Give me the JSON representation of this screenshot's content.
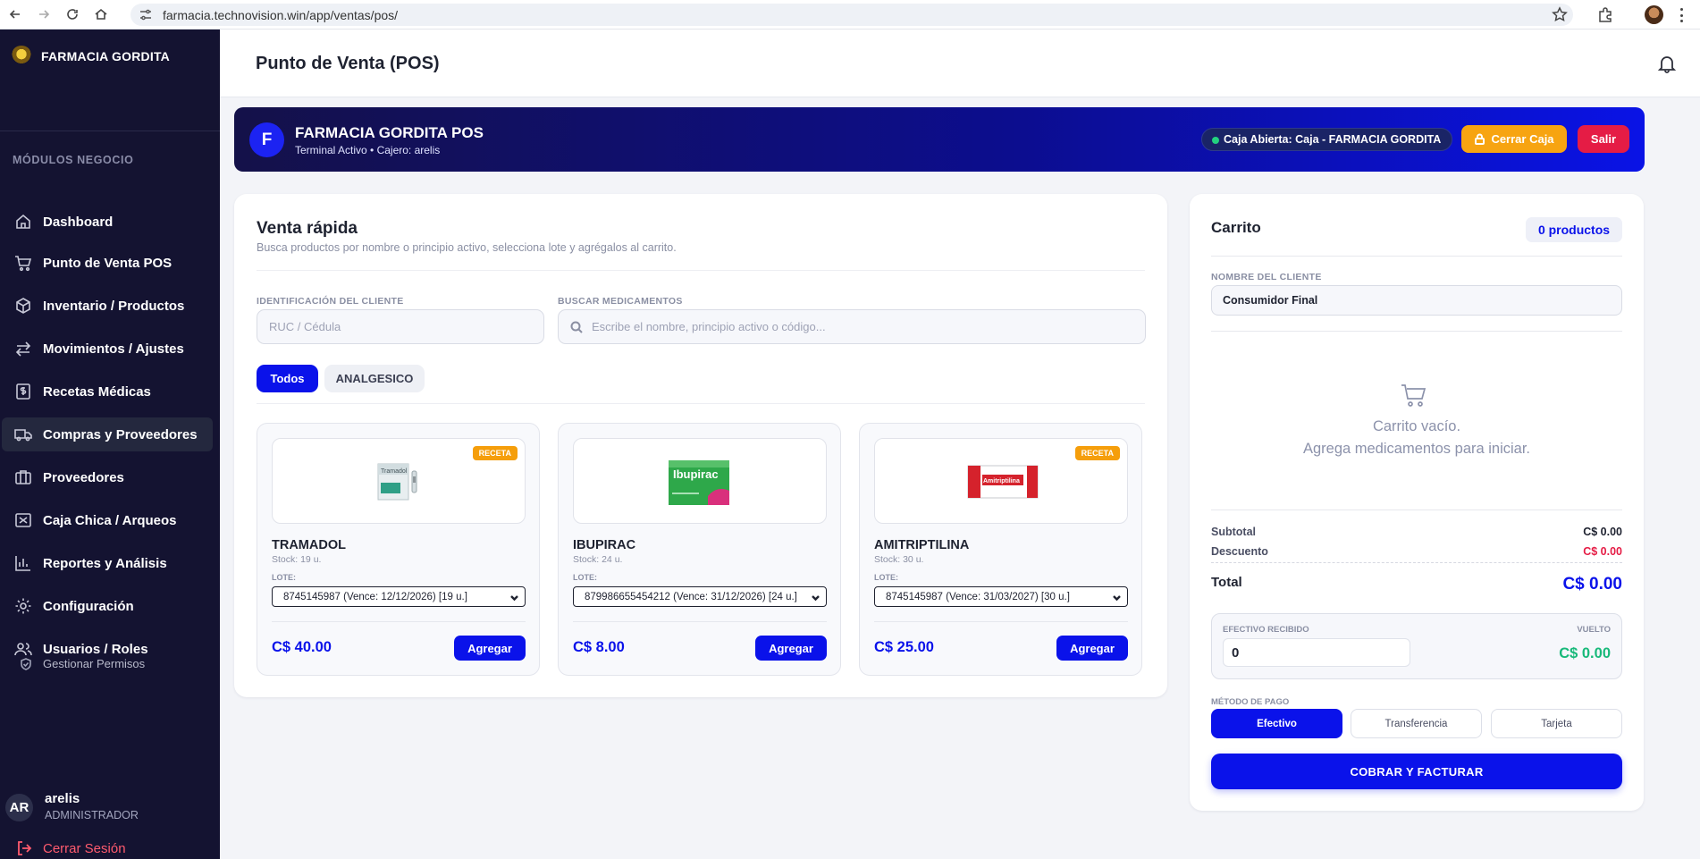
{
  "browser": {
    "url": "farmacia.technovision.win/app/ventas/pos/"
  },
  "sidebar": {
    "brand": "FARMACIA GORDITA",
    "section_label": "MÓDULOS NEGOCIO",
    "items": [
      {
        "label": "Dashboard",
        "icon": "home-icon"
      },
      {
        "label": "Punto de Venta POS",
        "icon": "cart-icon"
      },
      {
        "label": "Inventario / Productos",
        "icon": "box-icon"
      },
      {
        "label": "Movimientos / Ajustes",
        "icon": "arrows-icon"
      },
      {
        "label": "Recetas Médicas",
        "icon": "prescription-icon"
      },
      {
        "label": "Compras y Proveedores",
        "icon": "truck-icon",
        "active": true
      },
      {
        "label": "Proveedores",
        "icon": "building-icon"
      },
      {
        "label": "Caja Chica / Arqueos",
        "icon": "cash-icon"
      },
      {
        "label": "Reportes y Análisis",
        "icon": "chart-icon"
      },
      {
        "label": "Configuración",
        "icon": "gear-icon"
      },
      {
        "label": "Usuarios / Roles",
        "icon": "users-icon"
      }
    ],
    "sub_item": "Gestionar Permisos",
    "user": {
      "initials": "AR",
      "name": "arelis",
      "role": "ADMINISTRADOR"
    },
    "logout": "Cerrar Sesión"
  },
  "header": {
    "title": "Punto de Venta (POS)"
  },
  "banner": {
    "letter": "F",
    "title": "FARMACIA GORDITA POS",
    "subtitle": "Terminal Activo • Cajero: arelis",
    "status": "Caja Abierta: Caja - FARMACIA GORDITA",
    "close_cash": "Cerrar Caja",
    "exit": "Salir",
    "colors": {
      "status_dot": "#23d27f",
      "close_cash": "#f7a411",
      "exit": "#e51c45"
    }
  },
  "sale": {
    "title": "Venta rápida",
    "subtitle": "Busca productos por nombre o principio activo, selecciona lote y agrégalos al carrito.",
    "client_id_label": "IDENTIFICACIÓN DEL CLIENTE",
    "client_id_placeholder": "RUC / Cédula",
    "search_label": "BUSCAR MEDICAMENTOS",
    "search_placeholder": "Escribe el nombre, principio activo o código...",
    "filters": [
      "Todos",
      "ANALGESICO"
    ],
    "lote_label": "LOTE:",
    "add_label": "Agregar",
    "badge_label": "RECETA",
    "products": [
      {
        "name": "TRAMADOL",
        "stock": "Stock: 19 u.",
        "lote": "8745145987 (Vence: 12/12/2026) [19 u.]",
        "price": "C$ 40.00",
        "receta": true,
        "box_name": "Tramadol"
      },
      {
        "name": "IBUPIRAC",
        "stock": "Stock: 24 u.",
        "lote": "879986655454212 (Vence: 31/12/2026) [24 u.]",
        "price": "C$ 8.00",
        "receta": false,
        "box_name": "Ibupirac"
      },
      {
        "name": "AMITRIPTILINA",
        "stock": "Stock: 30 u.",
        "lote": "8745145987 (Vence: 31/03/2027) [30 u.]",
        "price": "C$ 25.00",
        "receta": true,
        "box_name": "Amitriptilina"
      }
    ]
  },
  "cart": {
    "title": "Carrito",
    "count": "0 productos",
    "client_label": "NOMBRE DEL CLIENTE",
    "client_value": "Consumidor Final",
    "empty_line1": "Carrito vacío.",
    "empty_line2": "Agrega medicamentos para iniciar.",
    "subtotal_label": "Subtotal",
    "subtotal": "C$ 0.00",
    "discount_label": "Descuento",
    "discount": "C$ 0.00",
    "total_label": "Total",
    "total": "C$ 0.00",
    "cash_label": "EFECTIVO RECIBIDO",
    "cash_value": "0",
    "change_label": "VUELTO",
    "change": "C$ 0.00",
    "payment_label": "MÉTODO DE PAGO",
    "payment_methods": [
      "Efectivo",
      "Transferencia",
      "Tarjeta"
    ],
    "charge": "COBRAR Y FACTURAR"
  }
}
